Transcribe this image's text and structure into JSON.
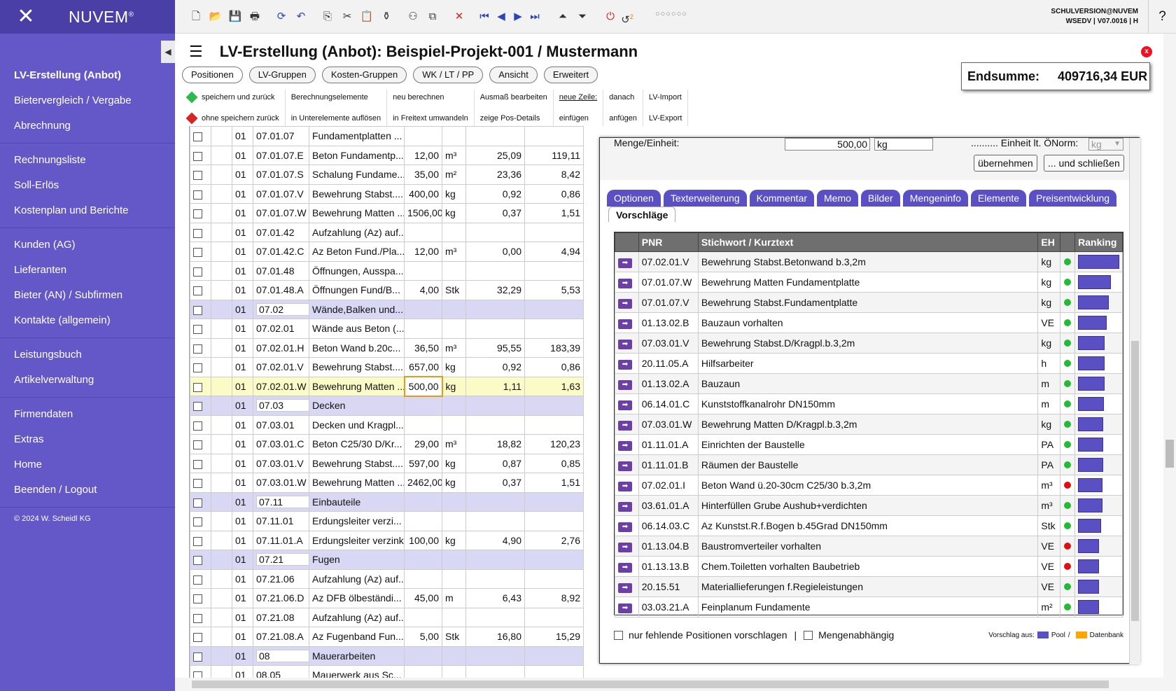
{
  "sidebar": {
    "logo": "NUVEM",
    "logo_reg": "®",
    "groups": [
      [
        "LV-Erstellung (Anbot)",
        "Bietervergleich / Vergabe",
        "Abrechnung"
      ],
      [
        "Rechnungsliste",
        "Soll-Erlös",
        "Kostenplan und Berichte"
      ],
      [
        "Kunden (AG)",
        "Lieferanten",
        "Bieter (AN) / Subfirmen",
        "Kontakte (allgemein)"
      ],
      [
        "Leistungsbuch",
        "Artikelverwaltung"
      ],
      [
        "Firmendaten",
        "Extras",
        "Home",
        "Beenden / Logout"
      ]
    ],
    "copyright": "© 2024 W. Scheidl KG"
  },
  "topbar": {
    "user": "SCHULVERSION@NUVEM",
    "version": "WSEDV | V07.0016 | H",
    "help": "?",
    "badge": "2",
    "dots": "○○○○○○"
  },
  "title": "LV-Erstellung (Anbot): Beispiel-Projekt-001 / Mustermann",
  "endsumme": {
    "label": "Endsumme:",
    "value": "409716,34 EUR"
  },
  "tabs": [
    "Positionen",
    "LV-Gruppen",
    "Kosten-Gruppen",
    "WK / LT / PP",
    "Ansicht",
    "Erweitert"
  ],
  "actions": [
    [
      "speichern und zurück",
      "ohne speichern zurück"
    ],
    [
      "Berechnungselemente",
      "in Unterelemente auflösen"
    ],
    [
      "neu berechnen",
      "in Freitext umwandeln"
    ],
    [
      "Ausmaß bearbeiten",
      "zeige Pos-Details"
    ],
    [
      "neue Zeile:",
      "einfügen"
    ],
    [
      "danach",
      "anfügen"
    ],
    [
      "LV-Import",
      "LV-Export"
    ]
  ],
  "rows": [
    {
      "g": "01",
      "code": "07.01.07",
      "text": "Fundamentplatten ...",
      "qty": "",
      "unit": "",
      "ep": "",
      "gp": "",
      "type": "normal"
    },
    {
      "g": "01",
      "code": "07.01.07.E",
      "text": "Beton Fundamentp...",
      "qty": "12,00",
      "unit": "m³",
      "ep": "25,09",
      "gp": "119,11",
      "type": "normal"
    },
    {
      "g": "01",
      "code": "07.01.07.S",
      "text": "Schalung Fundame...",
      "qty": "35,00",
      "unit": "m²",
      "ep": "23,36",
      "gp": "8,42",
      "type": "normal"
    },
    {
      "g": "01",
      "code": "07.01.07.V",
      "text": "Bewehrung Stabst....",
      "qty": "400,00",
      "unit": "kg",
      "ep": "0,92",
      "gp": "0,86",
      "type": "normal"
    },
    {
      "g": "01",
      "code": "07.01.07.W",
      "text": "Bewehrung Matten ...",
      "qty": "1506,00",
      "unit": "kg",
      "ep": "0,37",
      "gp": "1,51",
      "type": "normal"
    },
    {
      "g": "01",
      "code": "07.01.42",
      "text": "Aufzahlung (Az) auf...",
      "qty": "",
      "unit": "",
      "ep": "",
      "gp": "",
      "type": "normal"
    },
    {
      "g": "01",
      "code": "07.01.42.C",
      "text": "Az Beton Fund./Pla...",
      "qty": "12,00",
      "unit": "m³",
      "ep": "0,00",
      "gp": "4,94",
      "type": "normal"
    },
    {
      "g": "01",
      "code": "07.01.48",
      "text": "Öffnungen, Ausspa...",
      "qty": "",
      "unit": "",
      "ep": "",
      "gp": "",
      "type": "normal"
    },
    {
      "g": "01",
      "code": "07.01.48.A",
      "text": "Öffnungen Fund/B...",
      "qty": "4,00",
      "unit": "Stk",
      "ep": "32,29",
      "gp": "5,53",
      "type": "normal"
    },
    {
      "g": "01",
      "code": "07.02",
      "text": "Wände,Balken und...",
      "qty": "",
      "unit": "",
      "ep": "",
      "gp": "",
      "type": "group"
    },
    {
      "g": "01",
      "code": "07.02.01",
      "text": "Wände aus Beton (...",
      "qty": "",
      "unit": "",
      "ep": "",
      "gp": "",
      "type": "normal"
    },
    {
      "g": "01",
      "code": "07.02.01.H",
      "text": "Beton Wand b.20c...",
      "qty": "36,50",
      "unit": "m³",
      "ep": "95,55",
      "gp": "183,39",
      "type": "normal"
    },
    {
      "g": "01",
      "code": "07.02.01.V",
      "text": "Bewehrung Stabst....",
      "qty": "657,00",
      "unit": "kg",
      "ep": "0,92",
      "gp": "0,86",
      "type": "normal"
    },
    {
      "g": "01",
      "code": "07.02.01.W",
      "text": "Bewehrung Matten ...",
      "qty": "500,00",
      "unit": "kg",
      "ep": "1,11",
      "gp": "1,63",
      "type": "sel"
    },
    {
      "g": "01",
      "code": "07.03",
      "text": "Decken",
      "qty": "",
      "unit": "",
      "ep": "",
      "gp": "",
      "type": "group"
    },
    {
      "g": "01",
      "code": "07.03.01",
      "text": "Decken und Kragpl...",
      "qty": "",
      "unit": "",
      "ep": "",
      "gp": "",
      "type": "normal"
    },
    {
      "g": "01",
      "code": "07.03.01.C",
      "text": "Beton C25/30 D/Kr...",
      "qty": "29,00",
      "unit": "m³",
      "ep": "18,82",
      "gp": "120,23",
      "type": "normal"
    },
    {
      "g": "01",
      "code": "07.03.01.V",
      "text": "Bewehrung Stabst....",
      "qty": "597,00",
      "unit": "kg",
      "ep": "0,87",
      "gp": "0,85",
      "type": "normal"
    },
    {
      "g": "01",
      "code": "07.03.01.W",
      "text": "Bewehrung Matten ...",
      "qty": "2462,00",
      "unit": "kg",
      "ep": "0,37",
      "gp": "1,51",
      "type": "normal"
    },
    {
      "g": "01",
      "code": "07.11",
      "text": "Einbauteile",
      "qty": "",
      "unit": "",
      "ep": "",
      "gp": "",
      "type": "group"
    },
    {
      "g": "01",
      "code": "07.11.01",
      "text": "Erdungsleiter verzi...",
      "qty": "",
      "unit": "",
      "ep": "",
      "gp": "",
      "type": "normal"
    },
    {
      "g": "01",
      "code": "07.11.01.A",
      "text": "Erdungsleiter verzinkt",
      "qty": "100,00",
      "unit": "kg",
      "ep": "4,90",
      "gp": "2,76",
      "type": "normal"
    },
    {
      "g": "01",
      "code": "07.21",
      "text": "Fugen",
      "qty": "",
      "unit": "",
      "ep": "",
      "gp": "",
      "type": "group"
    },
    {
      "g": "01",
      "code": "07.21.06",
      "text": "Aufzahlung (Az) auf...",
      "qty": "",
      "unit": "",
      "ep": "",
      "gp": "",
      "type": "normal"
    },
    {
      "g": "01",
      "code": "07.21.06.D",
      "text": "Az DFB ölbeständi...",
      "qty": "45,00",
      "unit": "m",
      "ep": "6,43",
      "gp": "8,92",
      "type": "normal"
    },
    {
      "g": "01",
      "code": "07.21.08",
      "text": "Aufzahlung (Az) auf...",
      "qty": "",
      "unit": "",
      "ep": "",
      "gp": "",
      "type": "normal"
    },
    {
      "g": "01",
      "code": "07.21.08.A",
      "text": "Az Fugenband Fun...",
      "qty": "5,00",
      "unit": "Stk",
      "ep": "16,80",
      "gp": "15,29",
      "type": "normal"
    },
    {
      "g": "01",
      "code": "08",
      "text": "Mauerarbeiten",
      "qty": "",
      "unit": "",
      "ep": "",
      "gp": "",
      "type": "group"
    },
    {
      "g": "01",
      "code": "08.05",
      "text": "Mauerwerk aus Sc...",
      "qty": "",
      "unit": "",
      "ep": "",
      "gp": "",
      "type": "normal"
    }
  ],
  "popup": {
    "menge_label": "Menge/Einheit:",
    "menge_value": "500,00",
    "unit_value": "kg",
    "oenorm_label": ".......... Einheit lt. ÖNorm:",
    "oenorm_value": "kg",
    "btn_uebernehmen": "übernehmen",
    "btn_schliessen": "... und schließen",
    "tabs": [
      "Optionen",
      "Texterweiterung",
      "Kommentar",
      "Memo",
      "Bilder",
      "Mengeninfo",
      "Elemente",
      "Preisentwicklung"
    ],
    "active_tab": "Vorschläge",
    "headers": [
      "",
      "PNR",
      "Stichwort / Kurztext",
      "EH",
      "",
      "Ranking"
    ],
    "suggestions": [
      {
        "pnr": "07.02.01.V",
        "text": "Bewehrung Stabst.Betonwand b.3,2m",
        "eh": "kg",
        "status": "green",
        "rank": 1.0
      },
      {
        "pnr": "07.01.07.W",
        "text": "Bewehrung Matten Fundamentplatte",
        "eh": "kg",
        "status": "green",
        "rank": 0.79
      },
      {
        "pnr": "07.01.07.V",
        "text": "Bewehrung Stabst.Fundamentplatte",
        "eh": "kg",
        "status": "green",
        "rank": 0.75
      },
      {
        "pnr": "01.13.02.B",
        "text": "Bauzaun vorhalten",
        "eh": "VE",
        "status": "green",
        "rank": 0.69
      },
      {
        "pnr": "07.03.01.V",
        "text": "Bewehrung Stabst.D/Kragpl.b.3,2m",
        "eh": "kg",
        "status": "green",
        "rank": 0.65
      },
      {
        "pnr": "20.11.05.A",
        "text": "Hilfsarbeiter",
        "eh": "h",
        "status": "green",
        "rank": 0.65
      },
      {
        "pnr": "01.13.02.A",
        "text": "Bauzaun",
        "eh": "m",
        "status": "green",
        "rank": 0.65
      },
      {
        "pnr": "06.14.01.C",
        "text": "Kunststoffkanalrohr DN150mm",
        "eh": "m",
        "status": "green",
        "rank": 0.63
      },
      {
        "pnr": "07.03.01.W",
        "text": "Bewehrung Matten D/Kragpl.b.3,2m",
        "eh": "kg",
        "status": "green",
        "rank": 0.61
      },
      {
        "pnr": "01.11.01.A",
        "text": "Einrichten der Baustelle",
        "eh": "PA",
        "status": "green",
        "rank": 0.61
      },
      {
        "pnr": "01.11.01.B",
        "text": "Räumen der Baustelle",
        "eh": "PA",
        "status": "green",
        "rank": 0.61
      },
      {
        "pnr": "07.02.01.I",
        "text": "Beton Wand ü.20-30cm C25/30 b.3,2m",
        "eh": "m³",
        "status": "red",
        "rank": 0.59
      },
      {
        "pnr": "03.61.01.A",
        "text": "Hinterfüllen Grube Aushub+verdichten",
        "eh": "m³",
        "status": "green",
        "rank": 0.59
      },
      {
        "pnr": "06.14.03.C",
        "text": "Az Kunstst.R.f.Bogen b.45Grad DN150mm",
        "eh": "Stk",
        "status": "green",
        "rank": 0.55
      },
      {
        "pnr": "01.13.04.B",
        "text": "Baustromverteiler vorhalten",
        "eh": "VE",
        "status": "red",
        "rank": 0.51
      },
      {
        "pnr": "01.13.13.B",
        "text": "Chem.Toiletten vorhalten Baubetrieb",
        "eh": "VE",
        "status": "red",
        "rank": 0.51
      },
      {
        "pnr": "20.15.51",
        "text": "Materiallieferungen f.Regieleistungen",
        "eh": "VE",
        "status": "green",
        "rank": 0.51
      },
      {
        "pnr": "03.03.21.A",
        "text": "Feinplanum Fundamente",
        "eh": "m²",
        "status": "green",
        "rank": 0.51
      }
    ],
    "footer": {
      "chk1": "nur fehlende Positionen vorschlagen",
      "sep": "|",
      "chk2": "Mengenabhängig",
      "vsrc_label": "Vorschlag aus:",
      "pool": "Pool",
      "slash": "/",
      "db": "Datenbank",
      "pool_color": "#5b4fc4",
      "db_color": "#ffa500"
    }
  }
}
